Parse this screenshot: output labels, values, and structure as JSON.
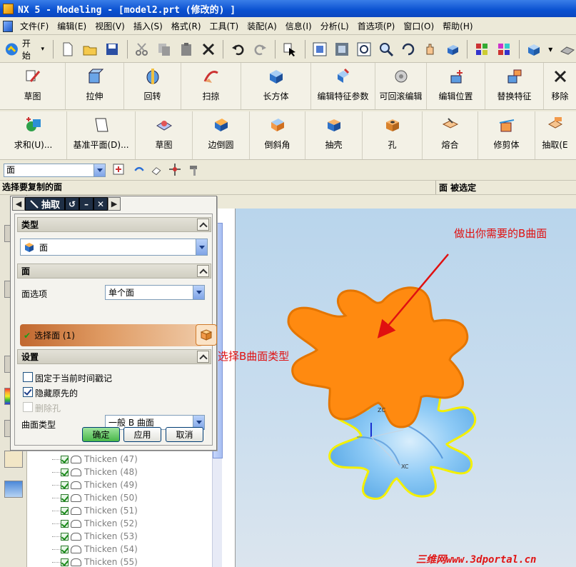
{
  "window": {
    "title": "NX 5 - Modeling - [model2.prt  (修改的) ]"
  },
  "menu": {
    "items": [
      "文件(F)",
      "编辑(E)",
      "视图(V)",
      "插入(S)",
      "格式(R)",
      "工具(T)",
      "装配(A)",
      "信息(I)",
      "分析(L)",
      "首选项(P)",
      "窗口(O)",
      "帮助(H)"
    ]
  },
  "toolbar": {
    "start_label": "开始"
  },
  "feature_toolbar": {
    "items": [
      "草图",
      "拉伸",
      "回转",
      "扫掠",
      "长方体",
      "编辑特征参数",
      "可回滚编辑",
      "编辑位置",
      "替换特征",
      "移除"
    ]
  },
  "feature_toolbar2": {
    "items": [
      "求和(U)...",
      "基准平面(D)...",
      "草图",
      "边倒圆",
      "倒斜角",
      "抽壳",
      "孔",
      "熔合",
      "修剪体",
      "抽取(E"
    ]
  },
  "selection_bar": {
    "filter": "面"
  },
  "prompt": {
    "left": "选择要复制的面",
    "right": "面 被选定"
  },
  "dialog": {
    "title": "抽取",
    "type_group": "类型",
    "type_value": "面",
    "face_group": "面",
    "face_option_label": "面选项",
    "face_option_value": "单个面",
    "select_face": "选择面 (1)",
    "settings_group": "设置",
    "fix_time_label": "固定于当前时间戳记",
    "hide_original_label": "隐藏原先的",
    "delete_holes_label": "删除孔",
    "surface_type_label": "曲面类型",
    "surface_type_value": "一般 B 曲面",
    "ok": "确定",
    "apply": "应用",
    "cancel": "取消"
  },
  "navigator": {
    "rows": [
      "Thicken (47)",
      "Thicken (48)",
      "Thicken (49)",
      "Thicken (50)",
      "Thicken (51)",
      "Thicken (52)",
      "Thicken (53)",
      "Thicken (54)",
      "Thicken (55)"
    ]
  },
  "viewport": {
    "axis_z": "ZC",
    "axis_x": "XC"
  },
  "annotations": {
    "top_right": "做出你需要的B曲面",
    "middle": "选择B曲面类型"
  },
  "watermark": "三维网www.3dportal.cn",
  "colors": {
    "orange_surface": "#ff8a0f",
    "blue_body": "#7cc2f5",
    "highlight_edge": "#f5f000",
    "annotation": "#e01010"
  }
}
